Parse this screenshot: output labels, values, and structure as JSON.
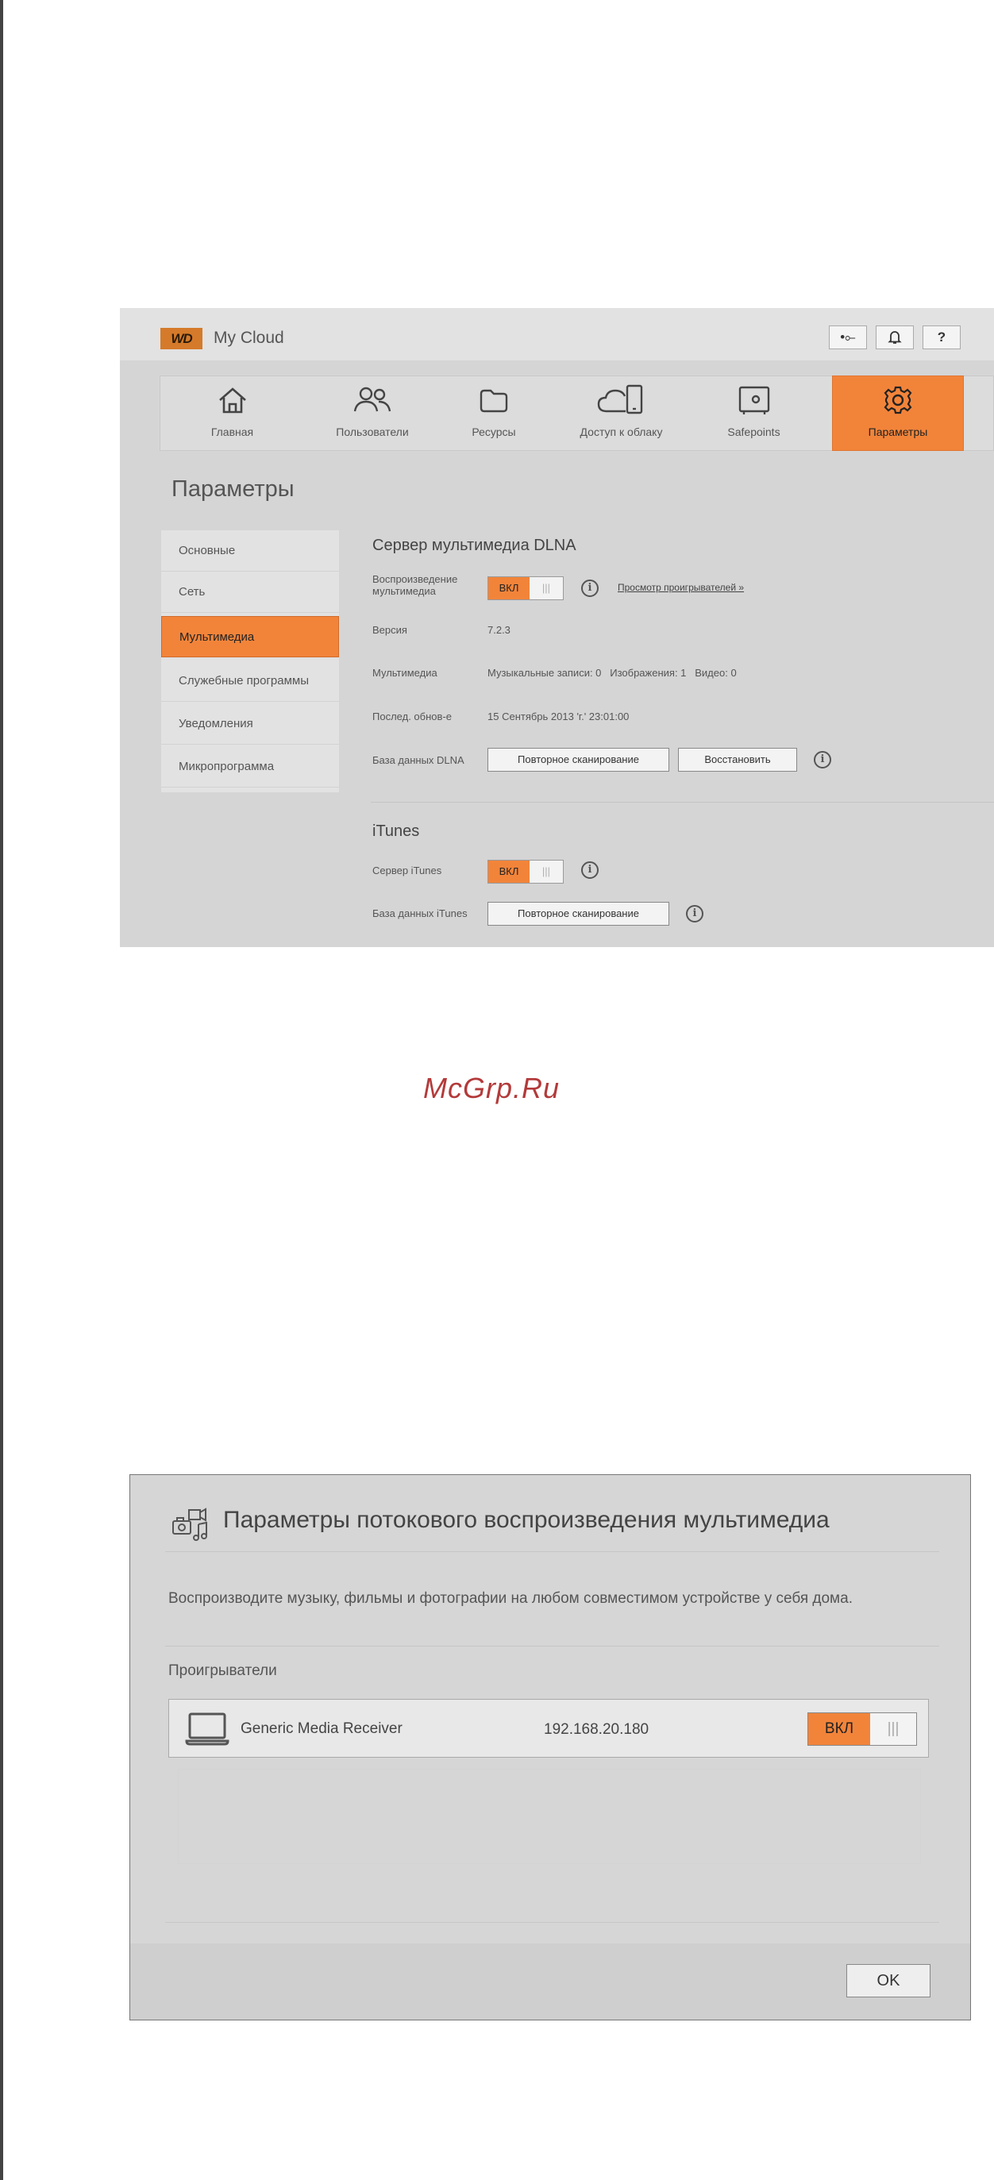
{
  "app": {
    "brand_logo": "WD",
    "brand_name": "My Cloud"
  },
  "toolbar": {
    "usb_glyph": "•⟜",
    "bell_glyph": "🔔",
    "help_label": "?"
  },
  "nav": {
    "items": [
      {
        "label": "Главная",
        "icon": "home-icon"
      },
      {
        "label": "Пользователи",
        "icon": "users-icon"
      },
      {
        "label": "Ресурсы",
        "icon": "folder-icon"
      },
      {
        "label": "Доступ к облаку",
        "icon": "cloud-device-icon"
      },
      {
        "label": "Safepoints",
        "icon": "safe-icon"
      },
      {
        "label": "Параметры",
        "icon": "gear-icon",
        "active": true
      }
    ]
  },
  "page": {
    "title": "Параметры"
  },
  "sidebar": {
    "items": [
      {
        "label": "Основные"
      },
      {
        "label": "Сеть"
      },
      {
        "label": "Мультимедиа",
        "active": true
      },
      {
        "label": "Служебные программы"
      },
      {
        "label": "Уведомления"
      },
      {
        "label": "Микропрограмма"
      }
    ]
  },
  "dlna": {
    "title": "Сервер мультимедиа DLNA",
    "playback_label": "Воспроизведение мультимедиа",
    "playback_toggle": "ВКЛ",
    "grip": "|||",
    "view_players_link": "Просмотр проигрывателей »",
    "version_label": "Версия",
    "version_value": "7.2.3",
    "media_label": "Мультимедиа",
    "media_value": "Музыкальные записи: 0   Изображения: 1   Видео: 0",
    "updated_label": "Послед. обнов-е",
    "updated_value": "15 Сентябрь 2013 'г.' 23:01:00",
    "db_label": "База данных DLNA",
    "rescan_button": "Повторное сканирование",
    "restore_button": "Восстановить"
  },
  "itunes": {
    "title": "iTunes",
    "server_label": "Сервер iTunes",
    "server_toggle": "ВКЛ",
    "grip": "|||",
    "db_label": "База данных iTunes",
    "rescan_button": "Повторное сканирование"
  },
  "watermark": "McGrp.Ru",
  "dialog": {
    "title": "Параметры потокового воспроизведения мультимедиа",
    "icon": "media-streaming-icon",
    "description": "Воспроизводите музыку, фильмы и фотографии на любом совместимом устройстве у себя дома.",
    "players_heading": "Проигрыватели",
    "players": [
      {
        "name": "Generic Media Receiver",
        "ip": "192.168.20.180",
        "toggle": "ВКЛ",
        "grip": "|||",
        "icon": "laptop-icon"
      }
    ],
    "ok_button": "OK"
  },
  "colors": {
    "accent": "#f2843a",
    "panel": "#d5d5d5",
    "watermark": "#b33a3a"
  }
}
